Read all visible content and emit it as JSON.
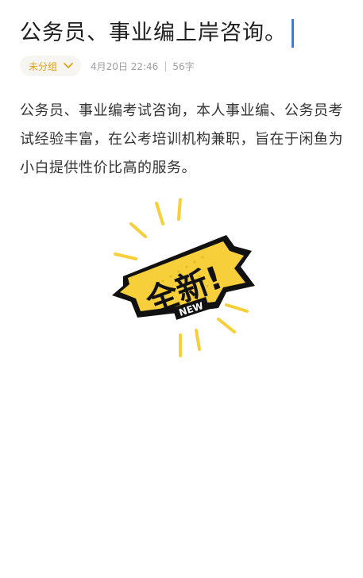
{
  "note": {
    "title": "公务员、事业编上岸咨询。",
    "group_label": "未分组",
    "date": "4月20日 22:46",
    "separator": "|",
    "char_count": "56字",
    "body": "公务员、事业编考试咨询，本人事业编、公务员考试经验丰富，在公考培训机构兼职，旨在于闲鱼为小白提供性价比高的服务。"
  },
  "sticker": {
    "main_text": "全新!",
    "sub_text": "NEW",
    "icon": "new-badge-sticker"
  },
  "colors": {
    "accent": "#2f7cf6",
    "group_label": "#d9a21b",
    "sticker_yellow": "#f7cf3a",
    "sticker_black": "#111111"
  }
}
